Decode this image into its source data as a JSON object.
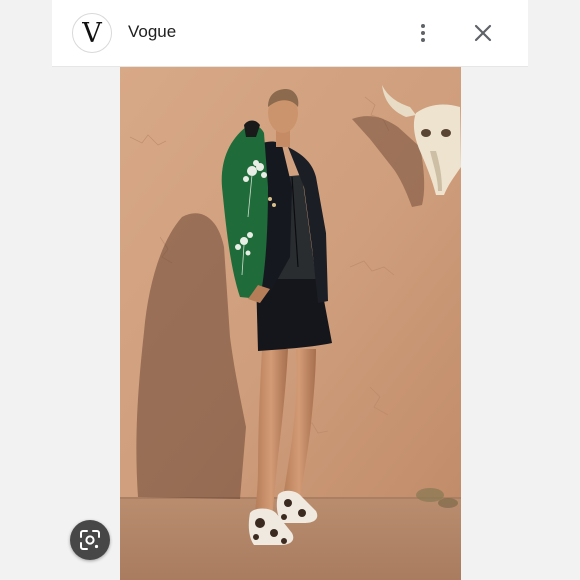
{
  "header": {
    "logo_letter": "V",
    "site_name": "Vogue",
    "more_icon": "more-vertical-icon",
    "close_icon": "close-icon"
  },
  "image": {
    "subject": "photo"
  },
  "lens_button": {
    "icon": "google-lens-icon"
  },
  "colors": {
    "wall": "#cf9e7c",
    "ground": "#b58a6c",
    "jacket": "#16181f",
    "scarf": "#1f6b3a",
    "lens_bg": "#474747"
  }
}
